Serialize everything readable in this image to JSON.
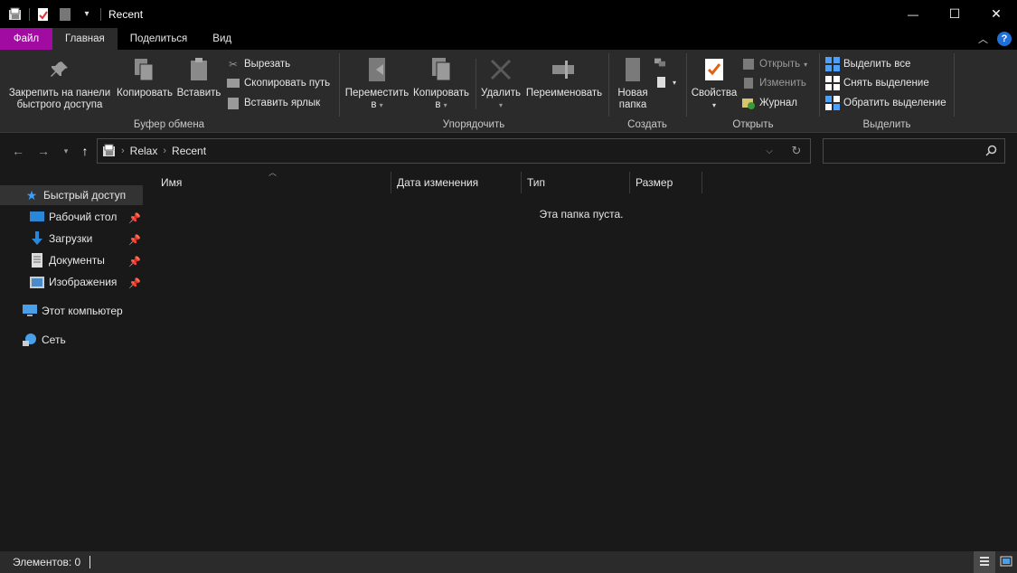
{
  "window": {
    "title": "Recent",
    "minimize_glyph": "—",
    "maximize_glyph": "☐",
    "close_glyph": "✕"
  },
  "tabs": [
    {
      "label": "Файл"
    },
    {
      "label": "Главная"
    },
    {
      "label": "Поделиться"
    },
    {
      "label": "Вид"
    }
  ],
  "ribbon": {
    "clipboard": {
      "pin_label_1": "Закрепить на панели",
      "pin_label_2": "быстрого доступа",
      "copy": "Копировать",
      "paste": "Вставить",
      "cut": "Вырезать",
      "copy_path": "Скопировать путь",
      "paste_shortcut": "Вставить ярлык",
      "group_label": "Буфер обмена"
    },
    "organize": {
      "move_1": "Переместить",
      "move_2": "в",
      "copy_1": "Копировать",
      "copy_2": "в",
      "delete": "Удалить",
      "rename": "Переименовать",
      "group_label": "Упорядочить"
    },
    "new": {
      "folder_1": "Новая",
      "folder_2": "папка",
      "group_label": "Создать"
    },
    "open": {
      "properties": "Свойства",
      "open": "Открыть",
      "edit": "Изменить",
      "history": "Журнал",
      "group_label": "Открыть"
    },
    "select": {
      "select_all": "Выделить все",
      "select_none": "Снять выделение",
      "invert": "Обратить выделение",
      "group_label": "Выделить"
    }
  },
  "address": {
    "crumbs": [
      "Relax",
      "Recent"
    ],
    "search_placeholder": ""
  },
  "nav": {
    "quick_access": "Быстрый доступ",
    "desktop": "Рабочий стол",
    "downloads": "Загрузки",
    "documents": "Документы",
    "pictures": "Изображения",
    "this_pc": "Этот компьютер",
    "network": "Сеть"
  },
  "columns": {
    "name": "Имя",
    "date": "Дата изменения",
    "type": "Тип",
    "size": "Размер"
  },
  "content": {
    "empty_message": "Эта папка пуста."
  },
  "status": {
    "items": "Элементов: 0"
  },
  "colors": {
    "file_tab": "#a20ba2",
    "accent_blue": "#1f6fd6"
  }
}
